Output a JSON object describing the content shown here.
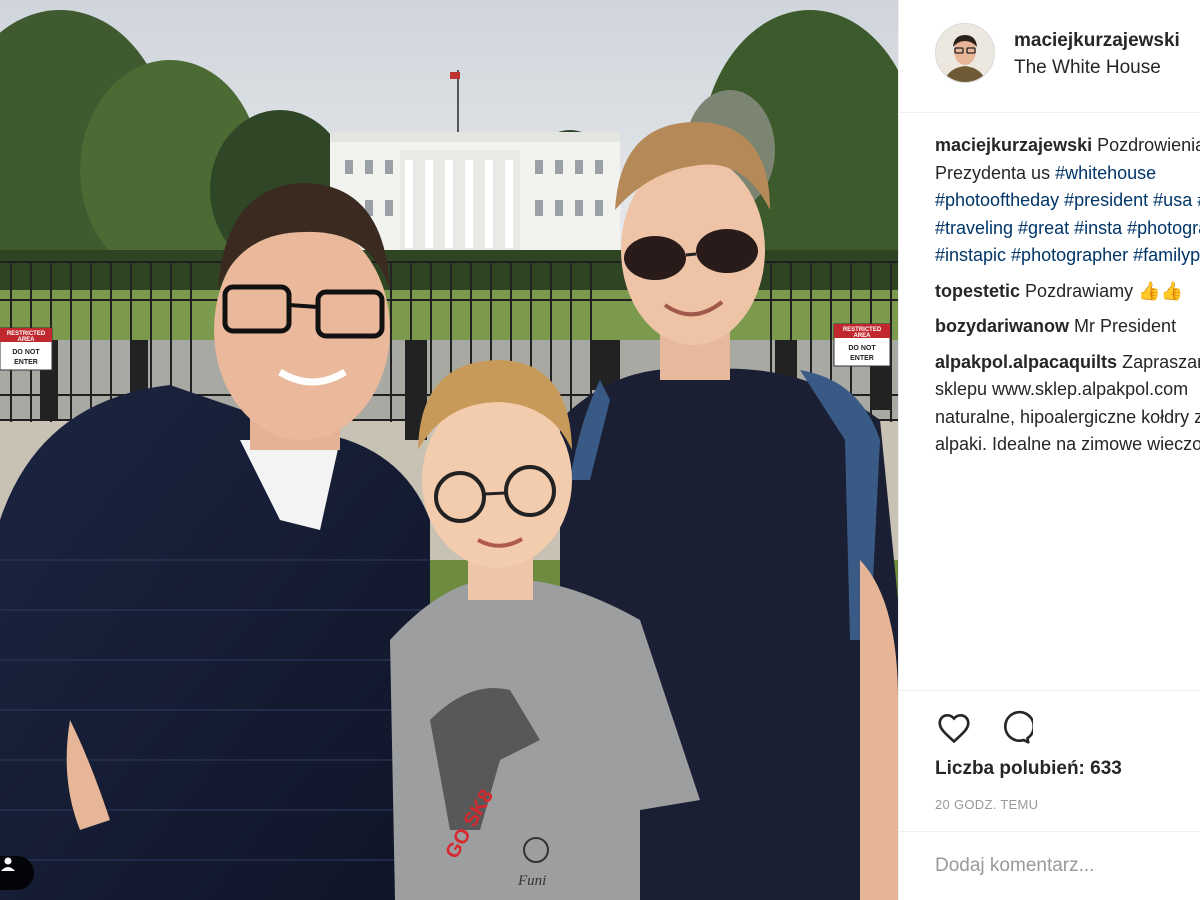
{
  "post": {
    "username": "maciejkurzajewski",
    "location": "The White House",
    "caption_text": "Pozdrowienia od Prezydenta us",
    "caption_hashtags": "#whitehouse #photooftheday #president #usa #travel #traveling #great #insta #photography #instapic #photographer #familypower"
  },
  "comments": [
    {
      "user": "topestetic",
      "text": "Pozdrawiamy 👍👍"
    },
    {
      "user": "bozydariwanow",
      "text": "Mr President"
    },
    {
      "user": "alpakpol.alpacaquilts",
      "text": "Zapraszamy do sklepu www.sklep.alpakpol.com naturalne, hipoalergiczne kołdry z wełny alpaki. Idealne na zimowe wieczory! ☺☺"
    }
  ],
  "actions": {
    "like_icon": "heart-icon",
    "comment_icon": "speech-bubble-icon",
    "likes_text": "Liczba polubień: 633",
    "time_text": "20 GODZ. TEMU",
    "add_comment_placeholder": "Dodaj komentarz..."
  },
  "photo": {
    "sign_left_line1": "RESTRICTED",
    "sign_left_line2": "AREA",
    "sign_left_line3": "DO NOT",
    "sign_left_line4": "ENTER",
    "sign_right_line1": "RESTRICTED",
    "sign_right_line2": "AREA",
    "sign_right_line3": "DO NOT",
    "sign_right_line4": "ENTER",
    "shirt_text": "GO SK8",
    "shirt_brand": "Funi",
    "user_tag_icon": "person-icon"
  },
  "colors": {
    "hashtag": "#003569",
    "border": "#efefef",
    "muted": "#999999"
  }
}
